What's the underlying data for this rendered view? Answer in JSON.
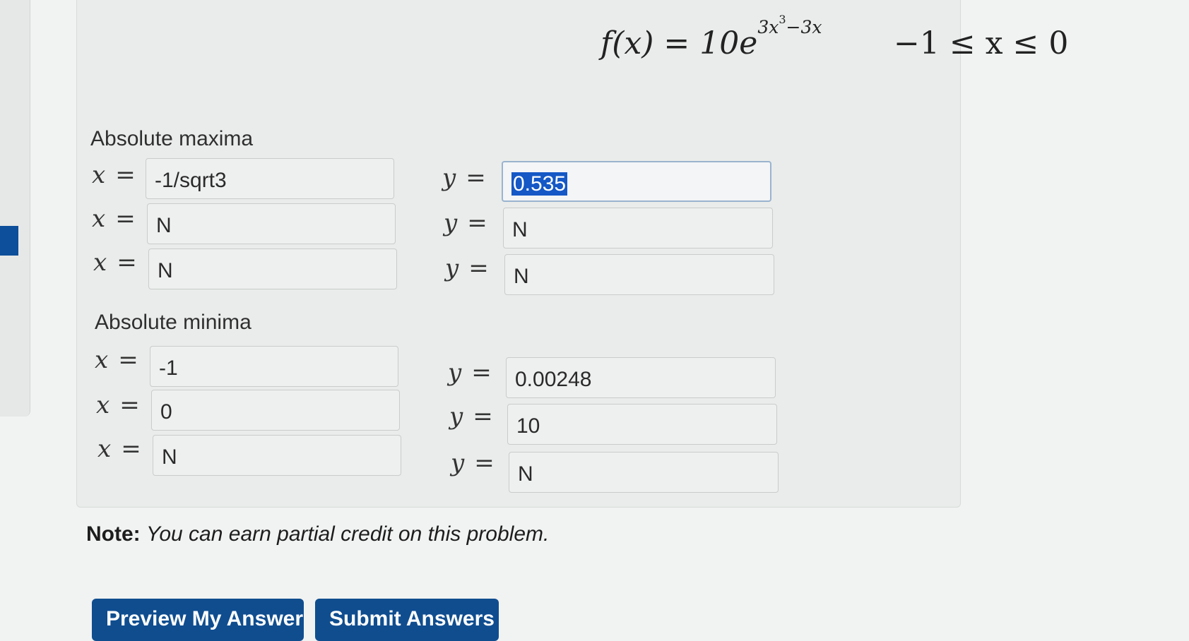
{
  "problem": {
    "function_lhs": "f(x) = 10e",
    "exponent_base": "3x",
    "exponent_power": "3",
    "exponent_tail": "−3x",
    "domain": "−1 ≤ x ≤ 0"
  },
  "labels": {
    "x_var": "x",
    "y_var": "y",
    "equals": "=",
    "absolute_maxima": "Absolute maxima",
    "absolute_minima": "Absolute minima"
  },
  "maxima": [
    {
      "x": "-1/sqrt3",
      "y": "0.535"
    },
    {
      "x": "N",
      "y": "N"
    },
    {
      "x": "N",
      "y": "N"
    }
  ],
  "minima": [
    {
      "x": "-1",
      "y": "0.00248"
    },
    {
      "x": "0",
      "y": "10"
    },
    {
      "x": "N",
      "y": "N"
    }
  ],
  "note": {
    "prefix": "Note:",
    "text": "You can earn partial credit on this problem."
  },
  "buttons": {
    "preview": "Preview My Answers",
    "submit": "Submit Answers"
  }
}
